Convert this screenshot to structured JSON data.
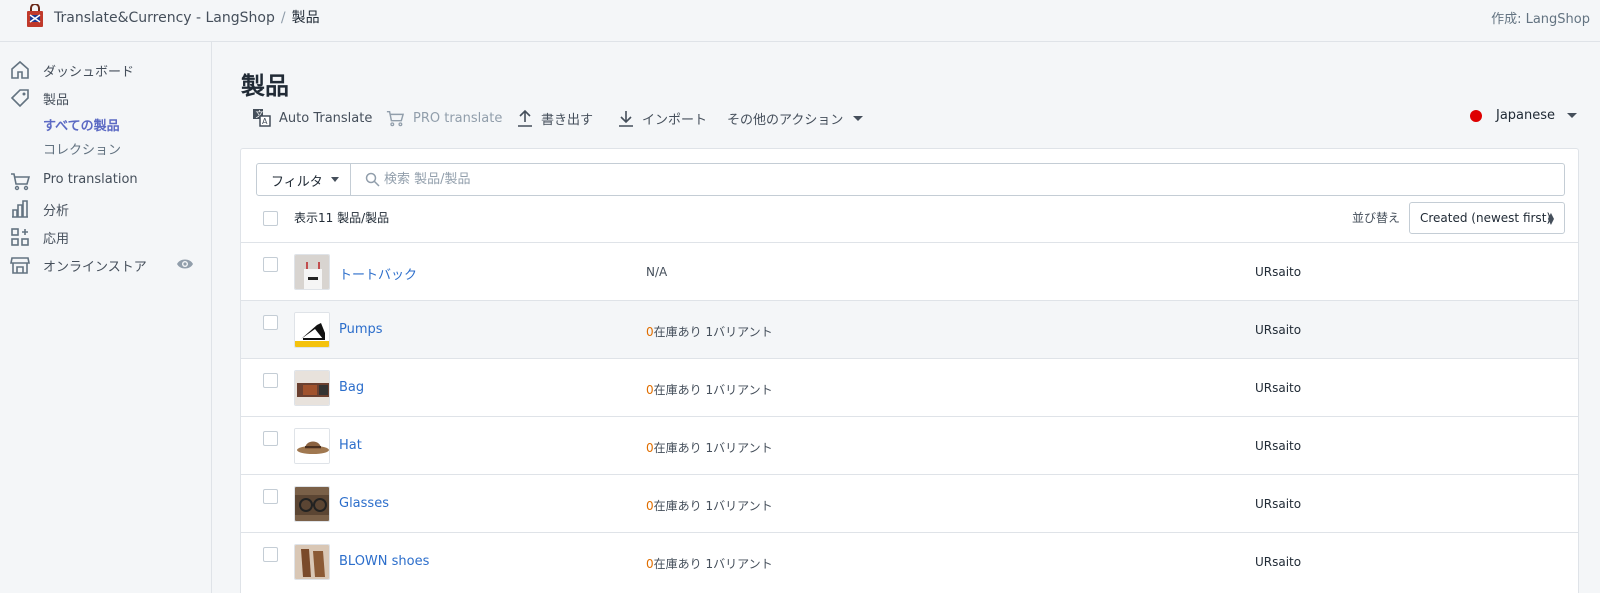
{
  "topbar": {
    "app_name": "Translate&Currency - LangShop",
    "separator": "/",
    "current_page": "製品",
    "byline": "作成: LangShop"
  },
  "sidebar": {
    "items": [
      {
        "label": "ダッシュボード",
        "icon": "home-icon"
      },
      {
        "label": "製品",
        "icon": "tag-icon"
      },
      {
        "label": "Pro translation",
        "icon": "cart-icon"
      },
      {
        "label": "分析",
        "icon": "bar-chart-icon"
      },
      {
        "label": "応用",
        "icon": "apps-icon"
      },
      {
        "label": "オンラインストア",
        "icon": "store-icon"
      }
    ],
    "sub_items": [
      {
        "label": "すべての製品",
        "active": true
      },
      {
        "label": "コレクション",
        "active": false
      }
    ]
  },
  "page": {
    "title": "製品",
    "actions": {
      "auto_translate": "Auto Translate",
      "pro_translate": "PRO translate",
      "export": "書き出す",
      "import": "インポート",
      "more": "その他のアクション"
    },
    "language": "Japanese"
  },
  "filters": {
    "filter_label": "フィルタ",
    "search_placeholder": "検索 製品/製品"
  },
  "list": {
    "count_label": "表示11 製品/製品",
    "sort_label": "並び替え",
    "sort_value": "Created (newest first)",
    "products": [
      {
        "name": "トートバック",
        "inventory_zero": "",
        "inventory_text": "N/A",
        "vendor": "URsaito"
      },
      {
        "name": "Pumps",
        "inventory_zero": "0",
        "inventory_text": "在庫あり 1バリアント",
        "vendor": "URsaito"
      },
      {
        "name": "Bag",
        "inventory_zero": "0",
        "inventory_text": "在庫あり 1バリアント",
        "vendor": "URsaito"
      },
      {
        "name": "Hat",
        "inventory_zero": "0",
        "inventory_text": "在庫あり 1バリアント",
        "vendor": "URsaito"
      },
      {
        "name": "Glasses",
        "inventory_zero": "0",
        "inventory_text": "在庫あり 1バリアント",
        "vendor": "URsaito"
      },
      {
        "name": "BLOWN shoes",
        "inventory_zero": "0",
        "inventory_text": "在庫あり 1バリアント",
        "vendor": "URsaito"
      }
    ]
  },
  "colors": {
    "link": "#2c6ecb",
    "active_nav": "#5c6ac4",
    "zero_stock": "#e06e00",
    "japan_flag": "#de0000"
  }
}
